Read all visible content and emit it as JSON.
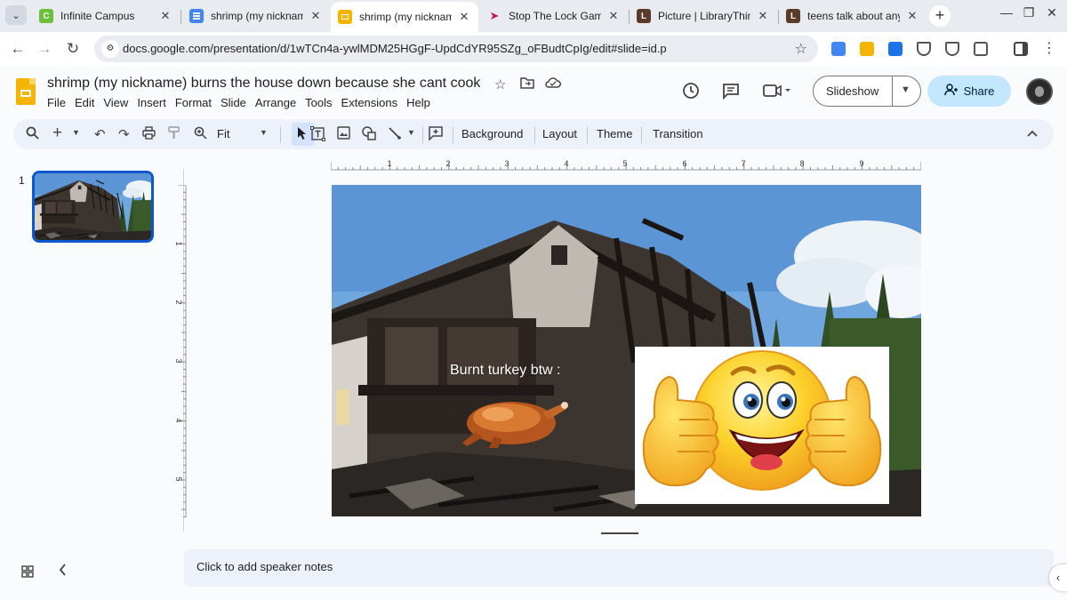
{
  "browser": {
    "tabs": [
      {
        "title": "Infinite Campus",
        "favicon": "campus-icon",
        "favicon_text": "C",
        "color": "#6bbf3a",
        "active": false
      },
      {
        "title": "shrimp (my nickname)",
        "favicon": "docs-icon",
        "favicon_text": "",
        "color": "#4285f4",
        "active": false
      },
      {
        "title": "shrimp (my nickname)",
        "favicon": "slides-icon",
        "favicon_text": "",
        "color": "#f4b400",
        "active": true
      },
      {
        "title": "Stop The Lock Game",
        "favicon": "arrow-icon",
        "favicon_text": "",
        "color": "#c2185b",
        "active": false
      },
      {
        "title": "Picture | LibraryThing",
        "favicon": "librarything-icon",
        "favicon_text": "L",
        "color": "#5b3a29",
        "active": false
      },
      {
        "title": "teens talk about anyth",
        "favicon": "librarything-icon",
        "favicon_text": "L",
        "color": "#5b3a29",
        "active": false
      }
    ],
    "tab_close_glyph": "✕",
    "new_tab_glyph": "+",
    "url": "docs.google.com/presentation/d/1wTCn4a-ywlMDM25HGgF-UpdCdYR95SZg_oFBudtCpIg/edit#slide=id.p"
  },
  "docs": {
    "title": "shrimp (my nickname) burns the house down because she cant cook",
    "menu": [
      "File",
      "Edit",
      "View",
      "Insert",
      "Format",
      "Slide",
      "Arrange",
      "Tools",
      "Extensions",
      "Help"
    ],
    "slideshow_label": "Slideshow",
    "share_label": "Share"
  },
  "toolbar": {
    "zoom": "Fit",
    "background_label": "Background",
    "layout_label": "Layout",
    "theme_label": "Theme",
    "transition_label": "Transition"
  },
  "rulers": {
    "horizontal": [
      "1",
      "2",
      "3",
      "4",
      "5",
      "6",
      "7",
      "8",
      "9"
    ],
    "vertical": [
      "1",
      "2",
      "3",
      "4",
      "5"
    ]
  },
  "filmstrip": {
    "slide_number": "1"
  },
  "slide": {
    "caption": "Burnt turkey btw :",
    "background_image": "burnt-house-image",
    "images": [
      "roast-turkey-image",
      "thumbs-up-emoji-image"
    ]
  },
  "notes": {
    "placeholder": "Click to add speaker notes"
  },
  "colors": {
    "accent": "#0b57d0",
    "share_bg": "#c2e7ff",
    "toolbar_bg": "#edf2fa"
  }
}
